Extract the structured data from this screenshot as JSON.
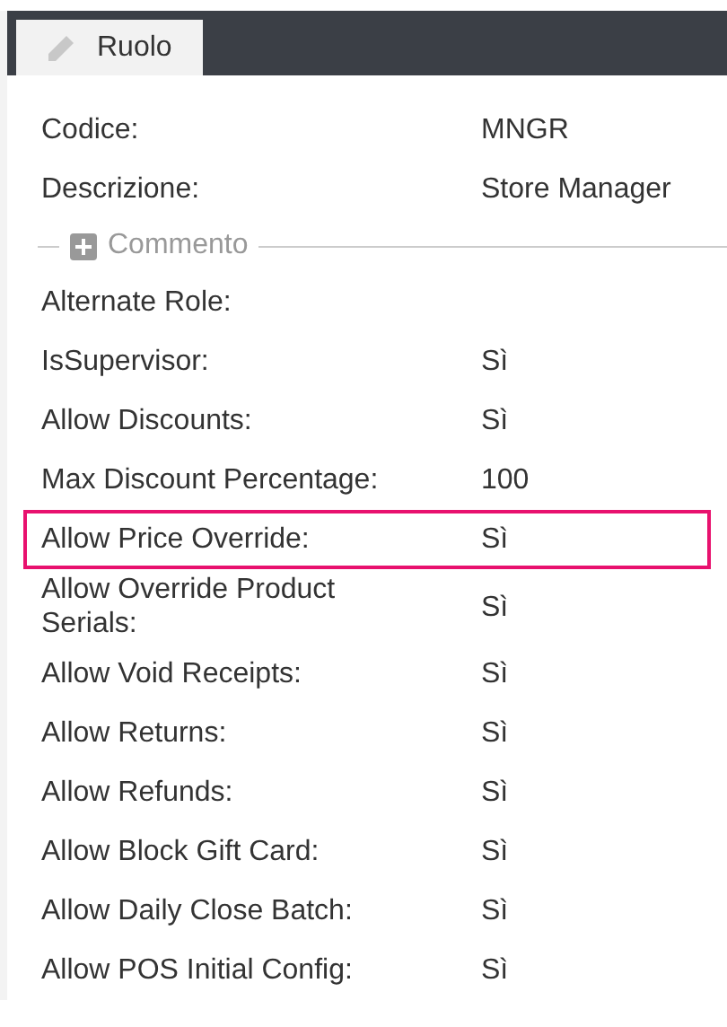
{
  "tab": {
    "label": "Ruolo",
    "selected": true
  },
  "rows": [
    {
      "kind": "field",
      "label": "Codice:",
      "value": "MNGR",
      "highlighted": false
    },
    {
      "kind": "field",
      "label": "Descrizione:",
      "value": "Store Manager",
      "highlighted": false
    },
    {
      "kind": "section",
      "label": "Commento",
      "expanded": false
    },
    {
      "kind": "field",
      "label": "Alternate Role:",
      "highlighted": false
    },
    {
      "kind": "field",
      "label": "IsSupervisor:",
      "value": "Sì",
      "highlighted": false
    },
    {
      "kind": "field",
      "label": "Allow Discounts:",
      "value": "Sì",
      "highlighted": false
    },
    {
      "kind": "field",
      "label": "Max Discount Percentage:",
      "value": "100",
      "highlighted": false
    },
    {
      "kind": "field",
      "label": "Allow Price Override:",
      "value": "Sì",
      "highlighted": true
    },
    {
      "kind": "field",
      "label": "Allow Override Product Serials:",
      "value": "Sì",
      "highlighted": false
    },
    {
      "kind": "field",
      "label": "Allow Void Receipts:",
      "value": "Sì",
      "highlighted": false
    },
    {
      "kind": "field",
      "label": "Allow Returns:",
      "value": "Sì",
      "highlighted": false
    },
    {
      "kind": "field",
      "label": "Allow Refunds:",
      "value": "Sì",
      "highlighted": false
    },
    {
      "kind": "field",
      "label": "Allow Block Gift Card:",
      "value": "Sì",
      "highlighted": false
    },
    {
      "kind": "field",
      "label": "Allow Daily Close Batch:",
      "value": "Sì",
      "highlighted": false
    },
    {
      "kind": "field",
      "label": "Allow POS Initial Config:",
      "value": "Sì",
      "highlighted": false
    }
  ]
}
